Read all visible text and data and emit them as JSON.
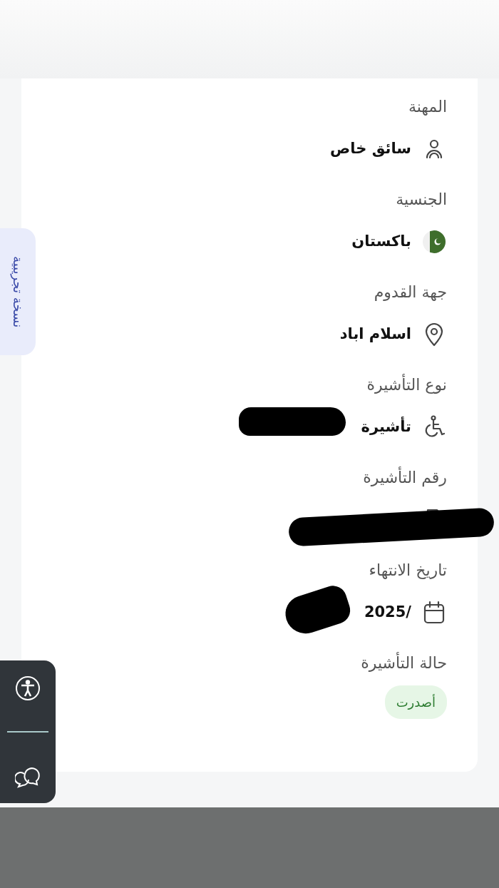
{
  "side_tab": {
    "label": "نسخة تجريبية"
  },
  "fields": [
    {
      "kind": "occupation",
      "label": "المهنة",
      "value": "سائق خاص"
    },
    {
      "kind": "nationality",
      "label": "الجنسية",
      "value": "باكستان"
    },
    {
      "kind": "origin",
      "label": "جهة القدوم",
      "value": "اسلام اباد"
    },
    {
      "kind": "visa-type",
      "label": "نوع التأشيرة",
      "value": "تأشيرة",
      "redacted": true
    },
    {
      "kind": "visa-number",
      "label": "رقم التأشيرة",
      "redacted": true
    },
    {
      "kind": "expiry",
      "label": "تاريخ الانتهاء",
      "value": "/2025",
      "redacted": true
    },
    {
      "kind": "status",
      "label": "حالة التأشيرة",
      "value": "أصدرت"
    }
  ]
}
